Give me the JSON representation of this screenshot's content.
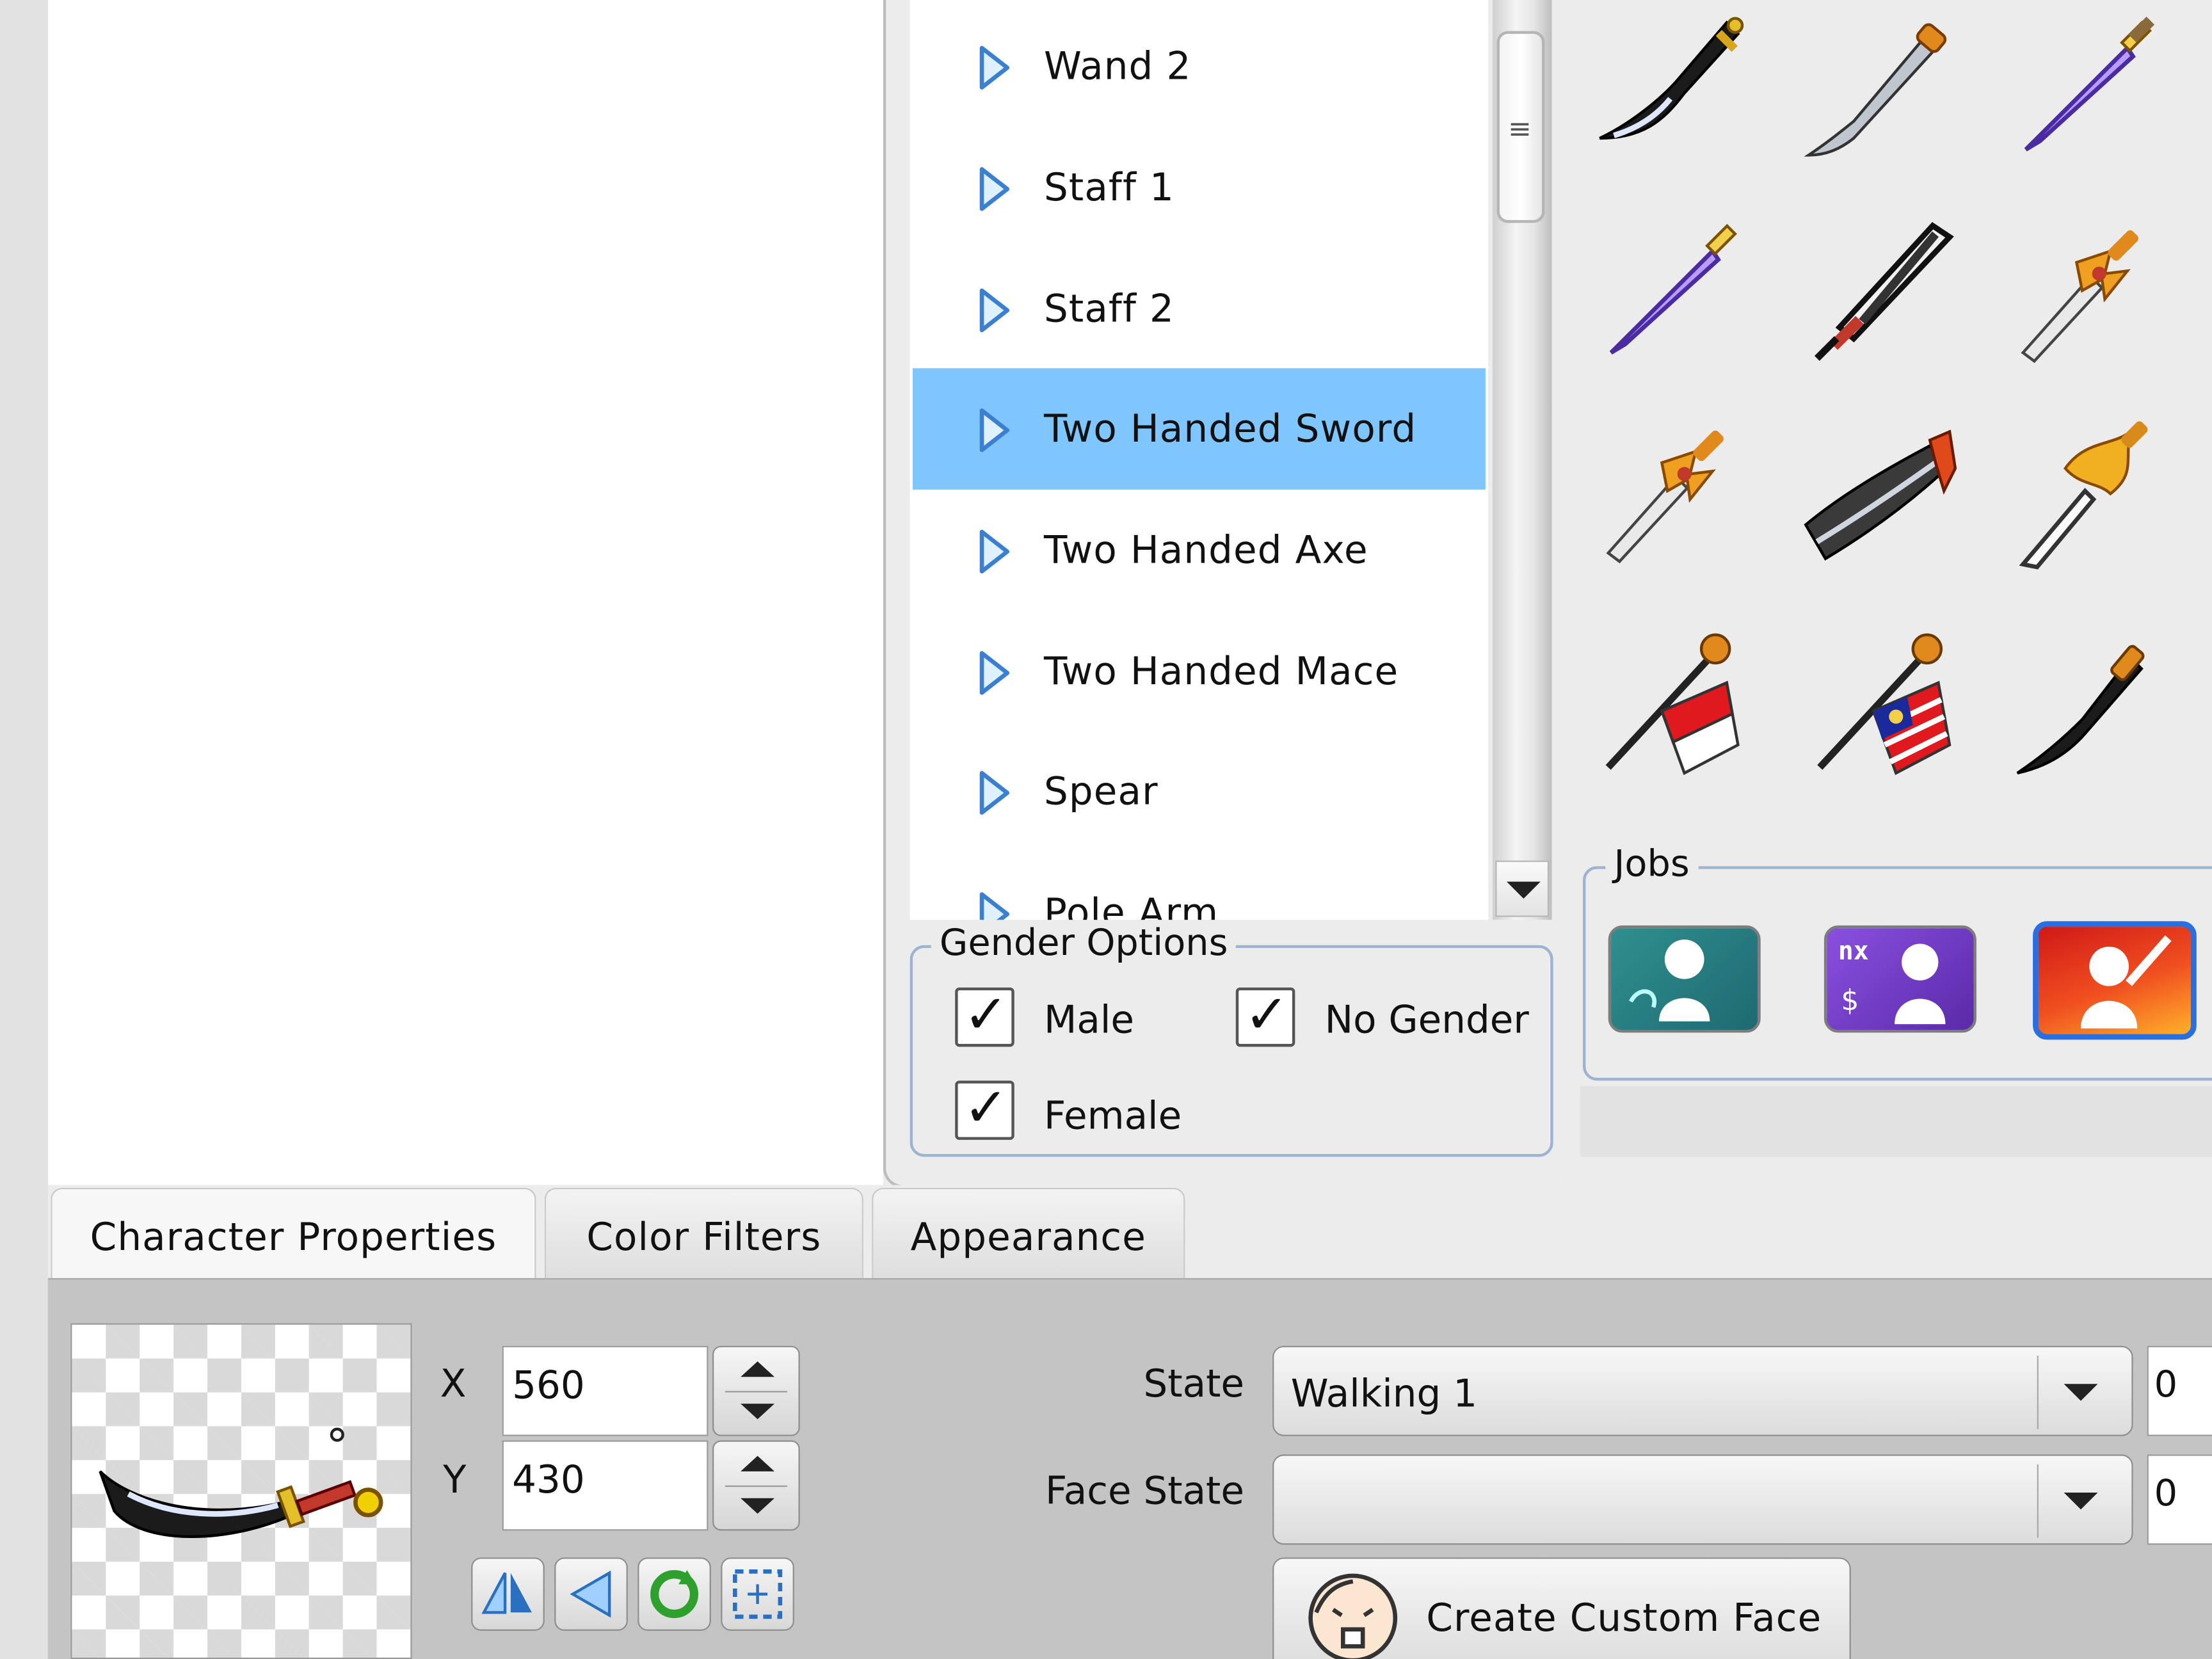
{
  "weapon_list": {
    "items": [
      {
        "label": "Wand 2",
        "selected": false
      },
      {
        "label": "Staff 1",
        "selected": false
      },
      {
        "label": "Staff 2",
        "selected": false
      },
      {
        "label": "Two Handed Sword",
        "selected": true
      },
      {
        "label": "Two Handed Axe",
        "selected": false
      },
      {
        "label": "Two Handed Mace",
        "selected": false
      },
      {
        "label": "Spear",
        "selected": false
      },
      {
        "label": "Pole Arm",
        "selected": false
      }
    ]
  },
  "gender_options": {
    "title": "Gender Options",
    "male": {
      "label": "Male",
      "checked": true
    },
    "no_gender": {
      "label": "No Gender",
      "checked": true
    },
    "female": {
      "label": "Female",
      "checked": true
    }
  },
  "jobs": {
    "title": "Jobs",
    "buttons": [
      {
        "icon": "job-explorer-icon",
        "selected": false
      },
      {
        "icon": "job-nx-cash-icon",
        "selected": false
      },
      {
        "icon": "job-warrior-icon",
        "selected": true
      }
    ]
  },
  "weapon_icons": [
    "scimitar-icon",
    "katana-icon",
    "purple-dagger-icon",
    "purple-dagger-icon",
    "broadsword-icon",
    "winged-sword-icon",
    "winged-sword-icon",
    "cleaver-icon",
    "phoenix-sword-icon",
    "singapore-flag-icon",
    "malaysia-flag-icon",
    "curved-blade-icon"
  ],
  "tabs": [
    {
      "label": "Character Properties",
      "active": true
    },
    {
      "label": "Color Filters",
      "active": false
    },
    {
      "label": "Appearance",
      "active": false
    }
  ],
  "properties": {
    "x_label": "X",
    "x_value": "560",
    "y_label": "Y",
    "y_value": "430",
    "state_label": "State",
    "state_value": "Walking 1",
    "state_side_value": "0",
    "face_state_label": "Face State",
    "face_state_value": "",
    "face_state_side_value": "0",
    "create_face_label": "Create Custom Face"
  },
  "colors": {
    "selection": "#7fc6ff",
    "group_border": "#9cb3d1",
    "job_selected_border": "#2a6fe0"
  }
}
